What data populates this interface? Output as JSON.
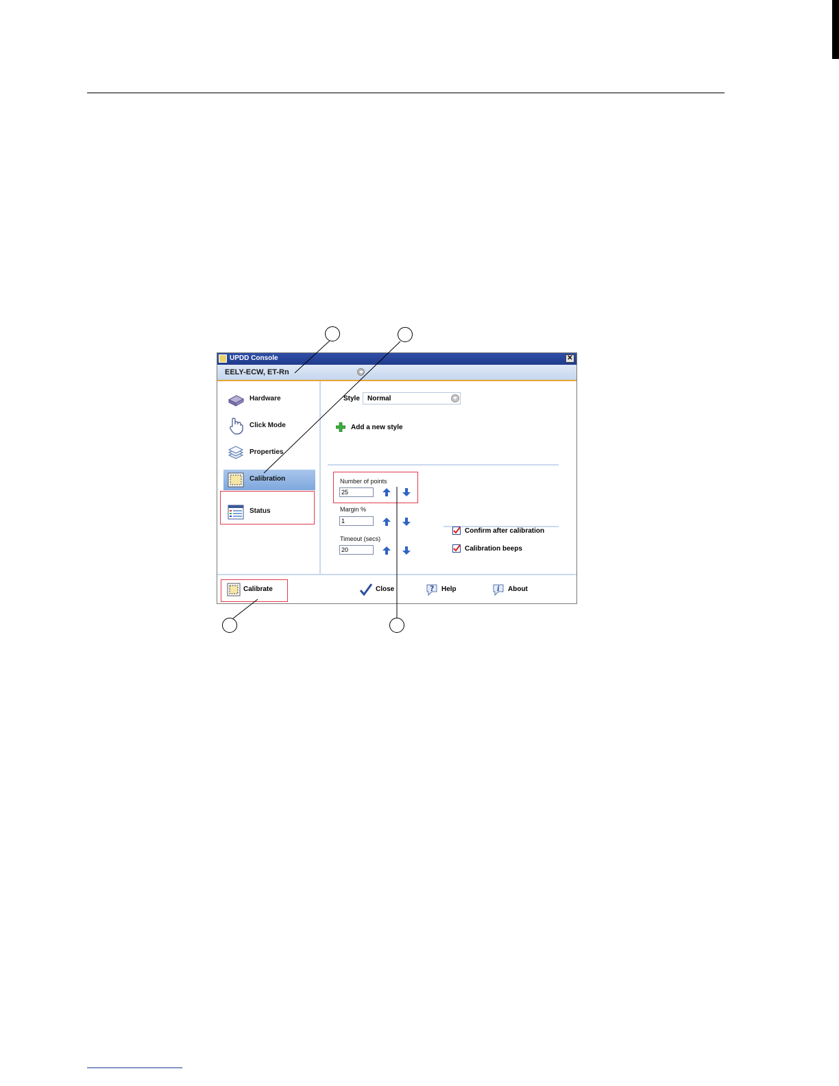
{
  "window": {
    "title": "UPDD Console",
    "close_glyph": "✕",
    "device_name": "EELY-ECW, ET-Rn"
  },
  "sidebar": {
    "items": [
      {
        "label": "Hardware",
        "icon": "hardware-drive-icon"
      },
      {
        "label": "Click Mode",
        "icon": "hand-pointer-icon"
      },
      {
        "label": "Properties",
        "icon": "layers-icon"
      },
      {
        "label": "Calibration",
        "icon": "calibration-target-icon",
        "selected": true
      },
      {
        "label": "Status",
        "icon": "status-list-icon"
      }
    ]
  },
  "calibration_panel": {
    "style_label": "Style",
    "style_value": "Normal",
    "add_style_label": "Add a new style",
    "fields": [
      {
        "label": "Number of points",
        "value": "25"
      },
      {
        "label": "Margin %",
        "value": "1"
      },
      {
        "label": "Timeout (secs)",
        "value": "20"
      }
    ],
    "checkboxes": [
      {
        "label": "Confirm after calibration",
        "checked": true
      },
      {
        "label": "Calibration beeps",
        "checked": true
      }
    ]
  },
  "bottom_bar": {
    "calibrate_label": "Calibrate",
    "close_label": "Close",
    "help_label": "Help",
    "about_label": "About"
  },
  "colors": {
    "titlebar": "#1f3b8c",
    "selection": "#7ea7dd",
    "highlight_box": "#e03a4a",
    "arrow_blue": "#2f63c4",
    "accent_orange": "#e6a535"
  }
}
